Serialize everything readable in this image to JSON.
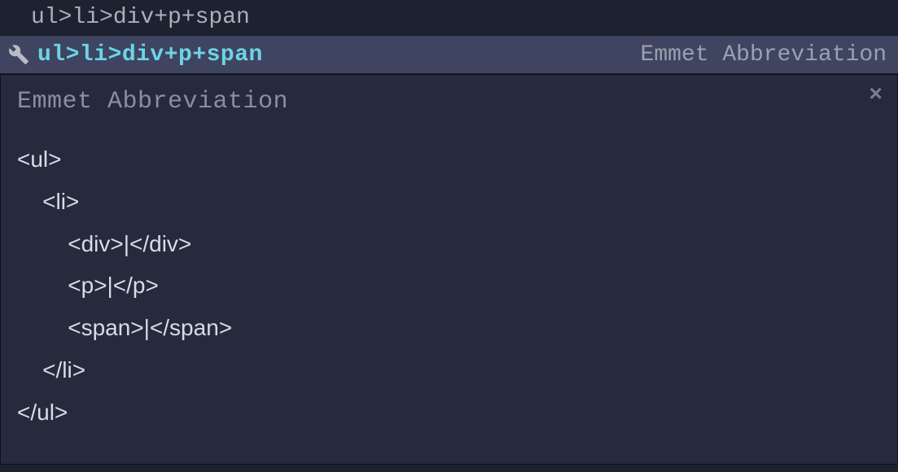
{
  "editor": {
    "input_text": "ul>li>div+p+span"
  },
  "suggestion": {
    "match_text": "ul>li>div+p+span",
    "category_label": "Emmet Abbreviation"
  },
  "preview": {
    "title": "Emmet Abbreviation",
    "code_lines": [
      "<ul>",
      "    <li>",
      "        <div>|</div>",
      "        <p>|</p>",
      "        <span>|</span>",
      "    </li>",
      "</ul>"
    ]
  },
  "icons": {
    "wrench": "wrench-icon",
    "close": "×"
  }
}
